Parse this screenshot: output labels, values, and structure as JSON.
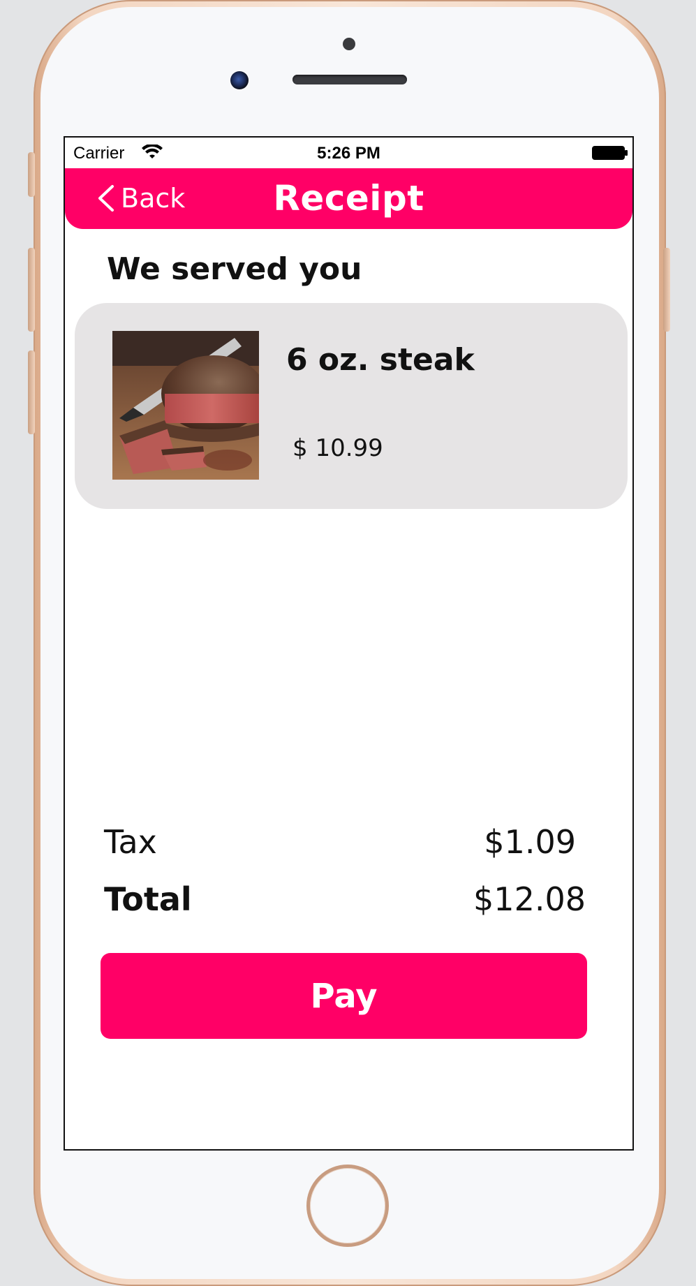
{
  "status_bar": {
    "carrier": "Carrier",
    "time": "5:26 PM",
    "wifi_icon": "wifi-icon",
    "battery_icon": "battery-icon"
  },
  "nav": {
    "back_label": "Back",
    "back_icon": "chevron-left-icon",
    "title": "Receipt"
  },
  "section": {
    "heading": "We served you"
  },
  "items": [
    {
      "name": "6 oz. steak",
      "price": "$ 10.99",
      "image_icon": "steak-photo"
    }
  ],
  "summary": {
    "tax_label": "Tax",
    "tax_value": "$1.09",
    "total_label": "Total",
    "total_value": "$12.08"
  },
  "actions": {
    "pay_label": "Pay"
  },
  "colors": {
    "accent": "#ff0066",
    "card_background": "#e6e4e5",
    "text": "#111111",
    "screen_background": "#ffffff"
  }
}
